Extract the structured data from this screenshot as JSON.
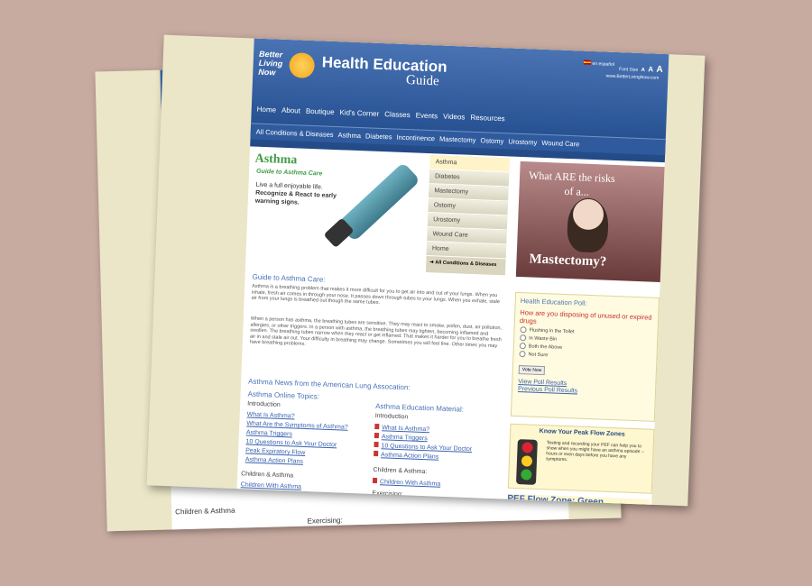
{
  "back_page": {
    "children_asthma": "Children & Asthma",
    "exercising": "Exercising:"
  },
  "header": {
    "logo": "Better Living Now",
    "title": "Health Education",
    "subtitle": "Guide",
    "lang": "en español",
    "font_size_label": "Font Size",
    "font_sizes": [
      "A",
      "A",
      "A"
    ],
    "url": "www.BetterLivingNow.com"
  },
  "nav": [
    "Home",
    "About",
    "Boutique",
    "Kid's Corner",
    "Classes",
    "Events",
    "Videos",
    "Resources"
  ],
  "catnav": [
    "All Conditions & Diseases",
    "Asthma",
    "Diabetes",
    "Incontinence",
    "Mastectomy",
    "Ostomy",
    "Urostomy",
    "Wound Care"
  ],
  "hero": {
    "title": "Asthma",
    "subtitle": "Guide to Asthma Care",
    "text_1": "Live a full enjoyable life.",
    "text_2": "Recognize & React to early warning signs."
  },
  "side_menu": {
    "items": [
      "Asthma",
      "Diabetes",
      "Mastectomy",
      "Ostomy",
      "Urostomy",
      "Wound Care",
      "Home"
    ],
    "all_link": "All Conditions & Diseases"
  },
  "promo": {
    "line1": "What ARE the risks",
    "line2": "of a...",
    "line3": "Mastectomy?"
  },
  "guide": {
    "title": "Guide to Asthma Care:",
    "para1": "Asthma is a breathing problem that makes it more difficult for you to get air into and out of your lungs. When you inhale, fresh air comes in through your nose. It passes down through tubes to your lungs. When you exhale, stale air from your lungs is breathed out though the same tubes.",
    "para2": "When a person has asthma, the breathing tubes are sensitive. They may react to smoke, pollen, dust, air pollution, allergies, or other triggers. In a person with asthma, the breathing tubes may tighten, becoming inflamed and swollen. The breathing tubes narrow when they react or get inflamed. That makes it harder for you to breathe fresh air in and stale air out. Your difficulty in breathing may change. Sometimes you will feel fine. Other times you may have breathing problems."
  },
  "news_title": "Asthma News from the American Lung Assocation:",
  "online_topics": {
    "title": "Asthma Online Topics:",
    "intro": "Introduction",
    "links": [
      "What Is Asthma?",
      "What Are the Symptoms of Asthma?",
      "Asthma Triggers",
      "10 Questions to Ask Your Doctor",
      "Peak Expiratory Flow",
      "Asthma Action Plans"
    ],
    "section2": "Children & Asthma",
    "section2_link": "Children With Asthma"
  },
  "education": {
    "title": "Asthma Education Material:",
    "intro": "Introduction",
    "links": [
      "What Is Asthma?",
      "Asthma Triggers",
      "10 Questions to Ask Your Doctor",
      "Asthma Action Plans"
    ],
    "section2": "Children & Asthma:",
    "section2_link": "Children With Asthma",
    "section3": "Exercising:"
  },
  "poll": {
    "title": "Health Education Poll:",
    "question": "How are you disposing of unused or expired drugs",
    "options": [
      "Flushing in the Toilet",
      "In Waste Bin",
      "Both the Above",
      "Not Sure"
    ],
    "vote_label": "Vote Now",
    "view_results": "View Poll Results",
    "previous_results": "Previous Poll Results"
  },
  "peak_flow": {
    "title": "Know Your Peak Flow Zones",
    "text": "Testing and recording your PEF can help you to show when you might have an asthma episode -- hours or even days before you have any symptoms.",
    "zone": "PEF Flow Zone: Green"
  }
}
